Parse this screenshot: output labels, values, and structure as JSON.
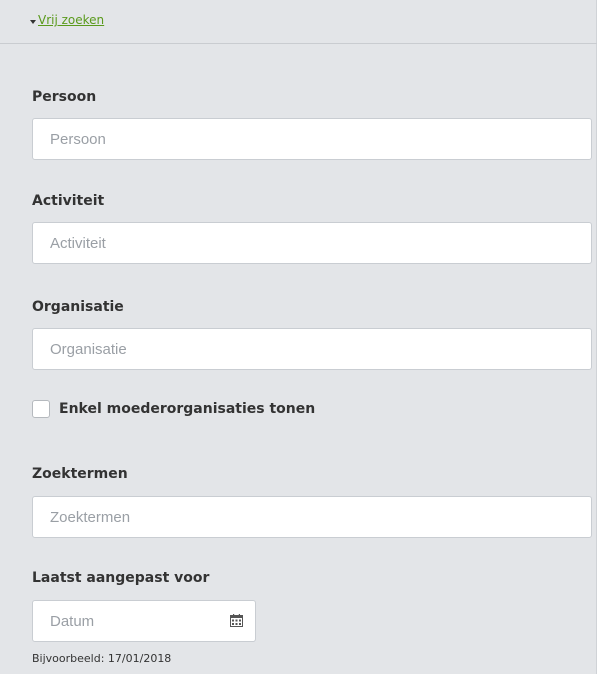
{
  "toggle": {
    "label": "Vrij zoeken",
    "icon": "caret-down-icon"
  },
  "fields": {
    "persoon": {
      "label": "Persoon",
      "placeholder": "Persoon",
      "value": ""
    },
    "activiteit": {
      "label": "Activiteit",
      "placeholder": "Activiteit",
      "value": ""
    },
    "organisatie": {
      "label": "Organisatie",
      "placeholder": "Organisatie",
      "value": ""
    },
    "zoektermen": {
      "label": "Zoektermen",
      "placeholder": "Zoektermen",
      "value": ""
    }
  },
  "checkbox": {
    "label": "Enkel moederorganisaties tonen",
    "checked": false
  },
  "date": {
    "label": "Laatst aangepast voor",
    "placeholder": "Datum",
    "value": "",
    "icon": "calendar-icon",
    "hint": "Bijvoorbeeld: 17/01/2018"
  },
  "colors": {
    "panel_background": "#e3e5e8",
    "link": "#5a9a1c",
    "label_text": "#333333",
    "placeholder_text": "#9a9fa5",
    "input_border": "#c9cdd2"
  }
}
